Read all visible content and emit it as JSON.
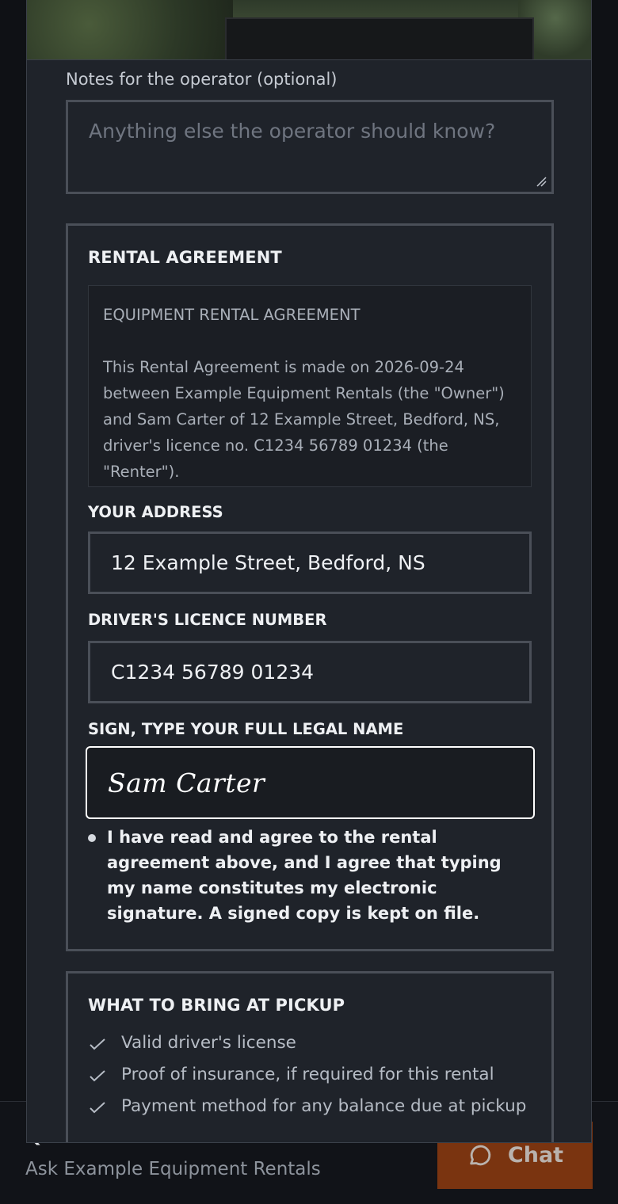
{
  "footer": {
    "questions_title": "Questions?",
    "questions_subtitle": "Ask Example Equipment Rentals",
    "chat_label": "Chat",
    "chat_icon": "chat-bubble-icon"
  },
  "notes": {
    "label": "Notes for the operator (optional)",
    "placeholder": "Anything else the operator should know?"
  },
  "agreement": {
    "title": "RENTAL AGREEMENT",
    "doc_heading": "EQUIPMENT RENTAL AGREEMENT",
    "doc_body": "This Rental Agreement is made on 2026-09-24 between Example Equipment Rentals (the \"Owner\") and Sam Carter of 12 Example Street, Bedford, NS, driver's licence no. C1234 56789 01234 (the \"Renter\").",
    "address_label": "YOUR ADDRESS",
    "address_value": "12 Example Street, Bedford, NS",
    "licence_label": "DRIVER'S LICENCE NUMBER",
    "licence_value": "C1234 56789 01234",
    "signature_label": "SIGN, TYPE YOUR FULL LEGAL NAME",
    "signature_value": "Sam Carter",
    "consent_text": "I have read and agree to the rental agreement above, and I agree that typing my name constitutes my electronic signature. A signed copy is kept on file."
  },
  "pickup": {
    "title": "WHAT TO BRING AT PICKUP",
    "items": [
      "Valid driver's license",
      "Proof of insurance, if required for this rental",
      "Payment method for any balance due at pickup"
    ],
    "item_icon": "checkmark-icon"
  },
  "colors": {
    "chat_button": "#7a3410",
    "panel": "#1f232a",
    "border": "#4a4f58"
  }
}
